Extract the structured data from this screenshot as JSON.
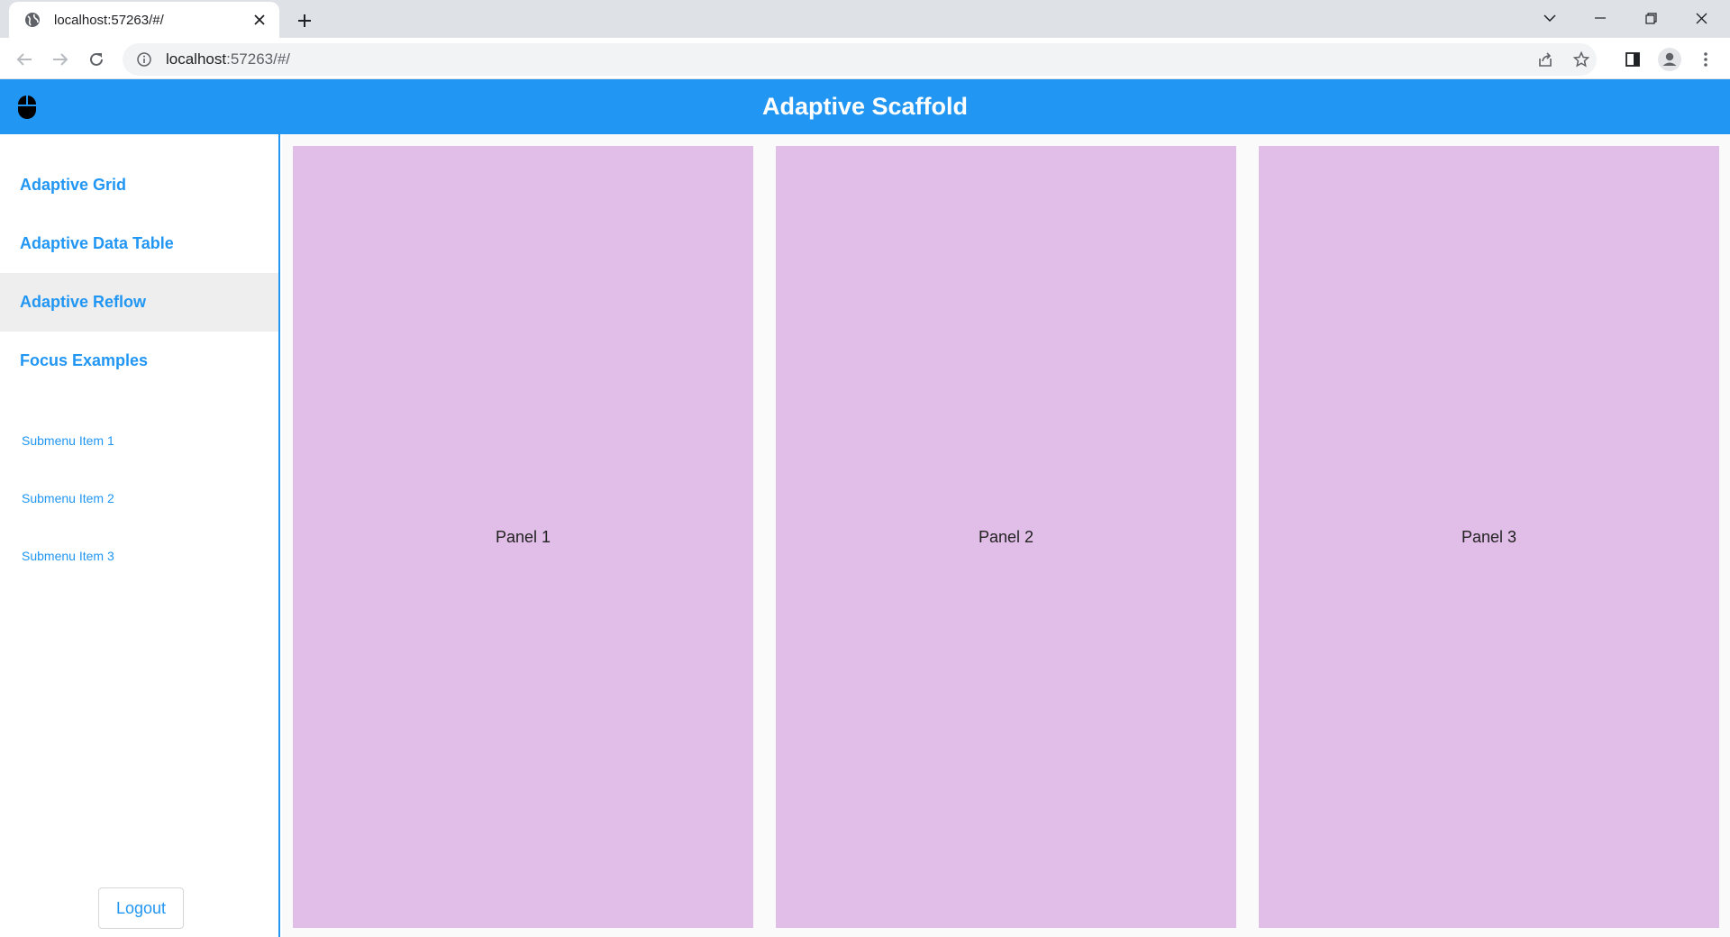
{
  "browser": {
    "tab": {
      "title": "localhost:57263/#/",
      "favicon": "globe-icon"
    },
    "omnibox": {
      "host": "localhost",
      "rest": ":57263/#/"
    }
  },
  "app": {
    "title": "Adaptive Scaffold",
    "accent_color": "#2196f3",
    "panel_color": "#e1bee7",
    "nav": [
      {
        "label": "Adaptive Grid",
        "selected": false
      },
      {
        "label": "Adaptive Data Table",
        "selected": false
      },
      {
        "label": "Adaptive Reflow",
        "selected": true
      },
      {
        "label": "Focus Examples",
        "selected": false
      }
    ],
    "submenu": [
      {
        "label": "Submenu Item 1"
      },
      {
        "label": "Submenu Item 2"
      },
      {
        "label": "Submenu Item 3"
      }
    ],
    "logout_label": "Logout",
    "panels": [
      {
        "label": "Panel 1"
      },
      {
        "label": "Panel 2"
      },
      {
        "label": "Panel 3"
      }
    ]
  }
}
